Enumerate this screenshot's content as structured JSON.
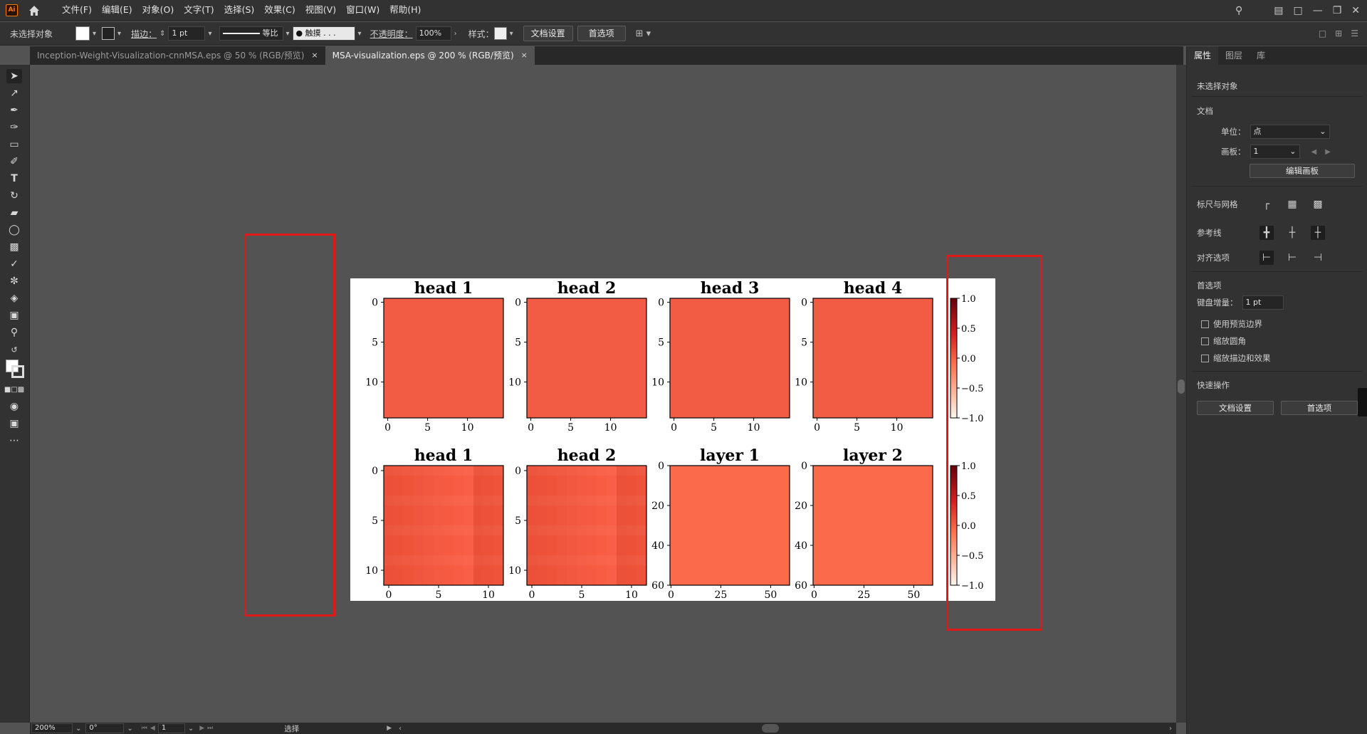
{
  "app": {
    "logo": "Ai",
    "home_icon": "home-icon"
  },
  "menu": [
    "文件(F)",
    "编辑(E)",
    "对象(O)",
    "文字(T)",
    "选择(S)",
    "效果(C)",
    "视图(V)",
    "窗口(W)",
    "帮助(H)"
  ],
  "control": {
    "selection": "未选择对象",
    "stroke_label": "描边：",
    "stroke_value": "1 pt",
    "stroke_profile": "等比",
    "brush": "● 触摸 . . .",
    "opacity_label": "不透明度：",
    "opacity_value": "100%",
    "style_label": "样式：",
    "doc_setup": "文档设置",
    "prefs": "首选项"
  },
  "tabs": [
    {
      "label": "Inception-Weight-Visualization-cnnMSA.eps @ 50 % (RGB/预览)",
      "close": "×",
      "active": false
    },
    {
      "label": "MSA-visualization.eps @ 200 % (RGB/预览)",
      "close": "×",
      "active": true
    }
  ],
  "panel": {
    "tabs": [
      "属性",
      "图层",
      "库"
    ],
    "none_selected": "未选择对象",
    "doc_section": "文档",
    "unit_label": "单位：",
    "unit_value": "点",
    "artboard_label": "画板：",
    "artboard_value": "1",
    "edit_artboards": "编辑画板",
    "rulers_grids": "标尺与网格",
    "guides": "参考线",
    "align_options": "对齐选项",
    "prefs_section": "首选项",
    "keyboard_inc_label": "键盘增量：",
    "keyboard_inc_value": "1 pt",
    "cb_preview_bounds": "使用预览边界",
    "cb_scale_corners": "缩放圆角",
    "cb_scale_strokes": "缩放描边和效果",
    "quick_actions": "快速操作",
    "qa_doc_setup": "文档设置",
    "qa_prefs": "首选项"
  },
  "status": {
    "zoom": "200%",
    "rotation": "0°",
    "artboard": "1",
    "tool": "选择"
  },
  "chart_data": {
    "type": "heatmap",
    "colormap": "Reds",
    "colorbar_ticks": [
      "1.0",
      "0.5",
      "0.0",
      "−0.5",
      "−1.0"
    ],
    "row1": [
      {
        "title": "head 1",
        "size": 15,
        "xticks": [
          "0",
          "5",
          "10"
        ],
        "yticks": [
          "0",
          "5",
          "10"
        ],
        "color": "#f25c45"
      },
      {
        "title": "head 2",
        "size": 15,
        "xticks": [
          "0",
          "5",
          "10"
        ],
        "yticks": [
          "0",
          "5",
          "10"
        ],
        "color": "#f25c45"
      },
      {
        "title": "head 3",
        "size": 15,
        "xticks": [
          "0",
          "5",
          "10"
        ],
        "yticks": [
          "0",
          "5",
          "10"
        ],
        "color": "#f25c45"
      },
      {
        "title": "head 4",
        "size": 15,
        "xticks": [
          "0",
          "5",
          "10"
        ],
        "yticks": [
          "0",
          "5",
          "10"
        ],
        "color": "#f25c45"
      }
    ],
    "row2": [
      {
        "title": "head 1",
        "size": 12,
        "xticks": [
          "0",
          "5",
          "10"
        ],
        "yticks": [
          "0",
          "5",
          "10"
        ],
        "color": "#f2573f"
      },
      {
        "title": "head 2",
        "size": 12,
        "xticks": [
          "0",
          "5",
          "10"
        ],
        "yticks": [
          "0",
          "5",
          "10"
        ],
        "color": "#f2573f"
      },
      {
        "title": "layer 1",
        "size": 60,
        "xticks": [
          "0",
          "25",
          "50"
        ],
        "yticks": [
          "0",
          "20",
          "40",
          "60"
        ],
        "color": "#fb6a4a"
      },
      {
        "title": "layer 2",
        "size": 60,
        "xticks": [
          "0",
          "25",
          "50"
        ],
        "yticks": [
          "0",
          "20",
          "40",
          "60"
        ],
        "color": "#fb6a4a"
      }
    ]
  }
}
